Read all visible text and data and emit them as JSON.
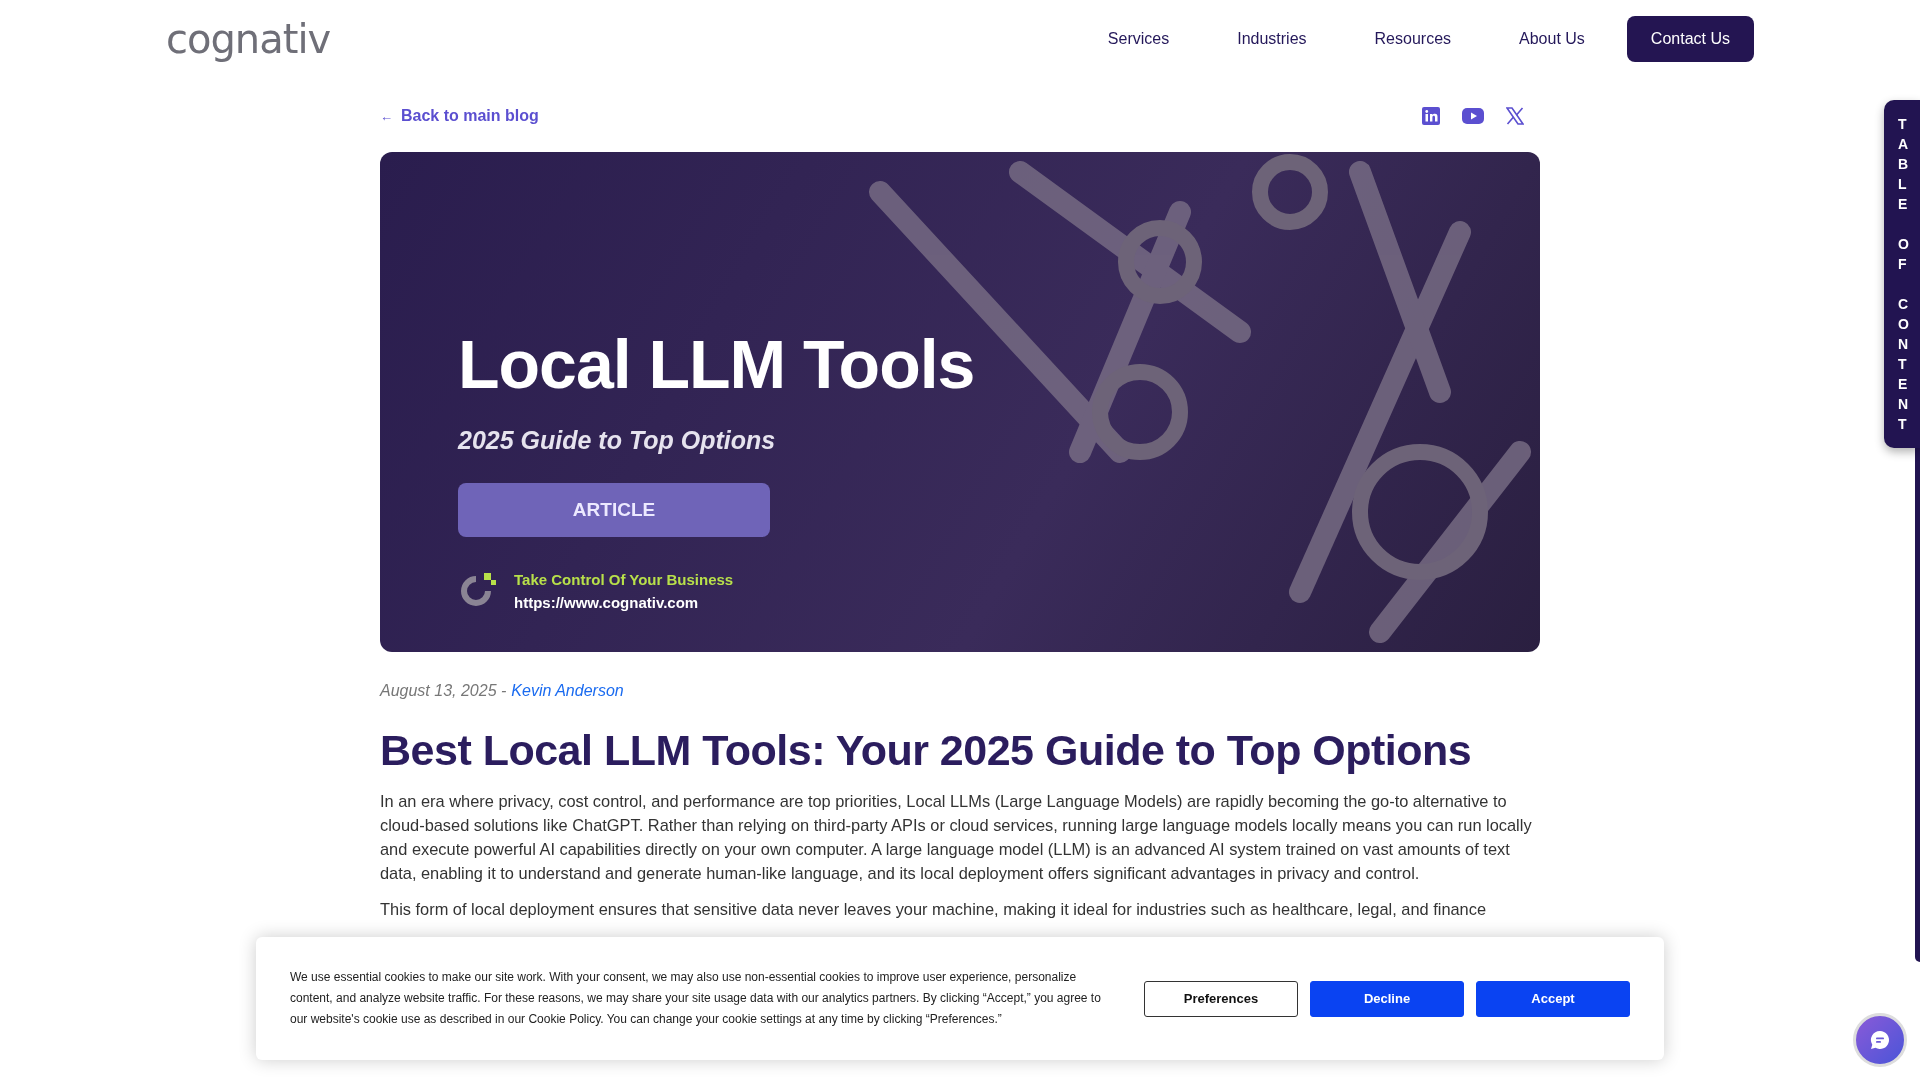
{
  "header": {
    "logo": "cognativ",
    "nav": [
      {
        "label": "Services",
        "kind": "link"
      },
      {
        "label": "Industries",
        "kind": "link"
      },
      {
        "label": "Resources",
        "kind": "link"
      },
      {
        "label": "About Us",
        "kind": "link"
      },
      {
        "label": "Contact Us",
        "kind": "cta"
      }
    ]
  },
  "back_link": {
    "arrow": "←",
    "label": "Back to main blog"
  },
  "social": [
    {
      "kind": "linkedin"
    },
    {
      "kind": "youtube"
    },
    {
      "kind": "x"
    }
  ],
  "hero": {
    "title": "Local LLM Tools",
    "subtitle": "2025 Guide to Top Options",
    "badge": "ARTICLE",
    "tagline": "Take Control Of Your Business",
    "url": "https://www.cognativ.com"
  },
  "meta": {
    "date": "August 13, 2025 -",
    "author": "Kevin Anderson"
  },
  "title": "Best Local LLM Tools: Your 2025 Guide to Top Options",
  "paragraphs": [
    "In an era where privacy, cost control, and performance are top priorities, Local LLMs (Large Language Models) are rapidly becoming the go-to alternative to cloud-based solutions like ChatGPT. Rather than relying on third-party APIs or cloud services, running large language models locally means you can run locally and execute powerful AI capabilities directly on your own computer. A large language model (LLM) is an advanced AI system trained on vast amounts of text data, enabling it to understand and generate human-like language, and its local deployment offers significant advantages in privacy and control.",
    "This form of local deployment ensures that sensitive data never leaves your machine, making it ideal for industries such as healthcare, legal, and finance"
  ],
  "toc": {
    "label": "TABLE OF CONTENT"
  },
  "cookie": {
    "text_before": "We use essential cookies to make our site work. With your consent, we may also use non-essential cookies to improve user experience, personalize content, and analyze website traffic. For these reasons, we may share your site usage data with our analytics partners. By clicking “Accept,” you agree to our website's cookie use as described in our",
    "policy_link": "Cookie Policy",
    "text_middle": ". You can change your cookie settings at any time by clicking “",
    "prefs_link": "Preferences",
    "text_after": ".”",
    "buttons": [
      {
        "label": "Preferences",
        "kind": "outline"
      },
      {
        "label": "Decline",
        "kind": "primary"
      },
      {
        "label": "Accept",
        "kind": "primary"
      }
    ]
  }
}
